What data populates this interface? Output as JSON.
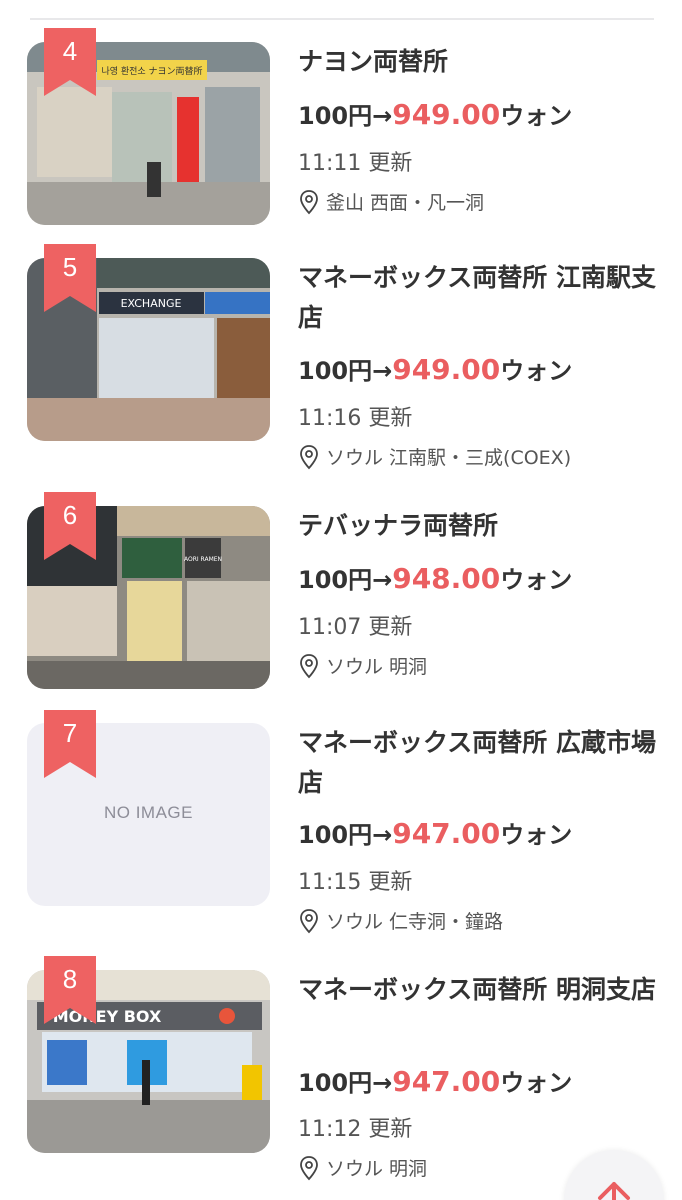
{
  "colors": {
    "accent": "#ea5e60",
    "badge": "#ee6262",
    "text": "#333333",
    "no_image_bg": "#efeff5"
  },
  "currency": {
    "base": "100円→",
    "unit": "ウォン"
  },
  "shops": [
    {
      "rank": "4",
      "name": "ナヨン両替所",
      "rate": "949.00",
      "updated": "11:11 更新",
      "location": "釜山 西面・凡一洞",
      "image": "photo"
    },
    {
      "rank": "5",
      "name": "マネーボックス両替所 江南駅支店",
      "rate": "949.00",
      "updated": "11:16 更新",
      "location": "ソウル 江南駅・三成(COEX)",
      "image": "photo"
    },
    {
      "rank": "6",
      "name": "テバッナラ両替所",
      "rate": "948.00",
      "updated": "11:07 更新",
      "location": "ソウル 明洞",
      "image": "photo"
    },
    {
      "rank": "7",
      "name": "マネーボックス両替所 広蔵市場店",
      "rate": "947.00",
      "updated": "11:15 更新",
      "location": "ソウル 仁寺洞・鐘路",
      "image": "none",
      "no_image_label": "NO IMAGE"
    },
    {
      "rank": "8",
      "name": "マネーボックス両替所 明洞支店",
      "rate": "947.00",
      "updated": "11:12 更新",
      "location": "ソウル 明洞",
      "image": "photo"
    }
  ],
  "photo_signage": {
    "shop4": "나영 환전소 ナヨン両替所",
    "shop5": "EXCHANGE",
    "shop6": "AORI RAMEN",
    "shop8": "MONEY BOX"
  },
  "icons": {
    "location": "map-pin-icon",
    "scroll_top": "arrow-up-icon",
    "rank": "ribbon-badge-icon"
  }
}
